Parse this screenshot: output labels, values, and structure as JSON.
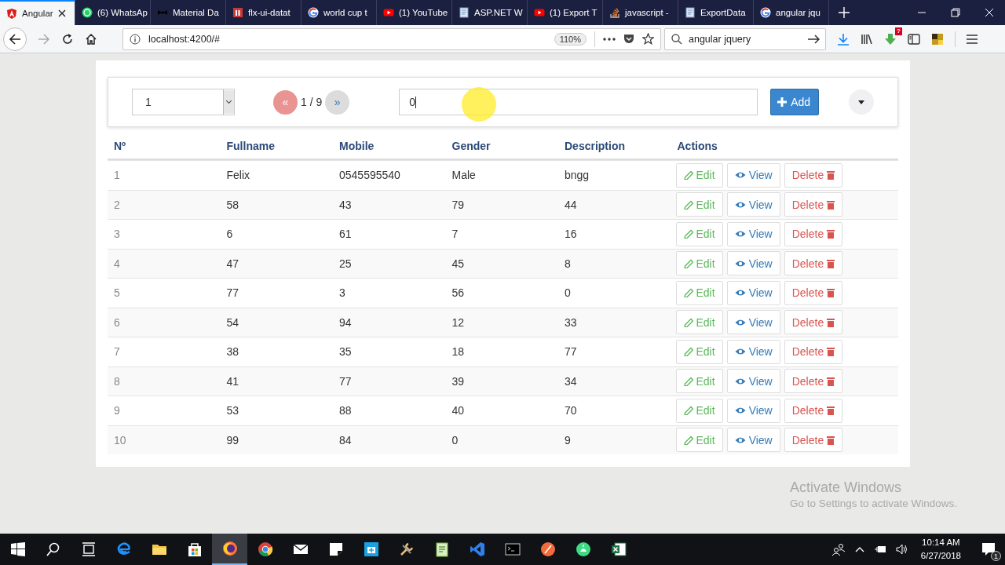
{
  "browser": {
    "tabs": [
      {
        "label": "Angular",
        "kind": "angular",
        "selected": true
      },
      {
        "label": "(6) WhatsAp",
        "kind": "whatsapp",
        "selected": false
      },
      {
        "label": "Material Da",
        "kind": "bowtie",
        "selected": false
      },
      {
        "label": "flx-ui-datat",
        "kind": "npm",
        "selected": false
      },
      {
        "label": "world cup t",
        "kind": "google",
        "selected": false
      },
      {
        "label": "(1) YouTube",
        "kind": "youtube",
        "selected": false
      },
      {
        "label": "ASP.NET W",
        "kind": "doc",
        "selected": false
      },
      {
        "label": "(1) Export T",
        "kind": "youtube",
        "selected": false
      },
      {
        "label": "javascript -",
        "kind": "stack",
        "selected": false
      },
      {
        "label": "ExportData",
        "kind": "doc",
        "selected": false
      },
      {
        "label": "angular jqu",
        "kind": "google",
        "selected": false
      }
    ],
    "url": "localhost:4200/#",
    "zoom": "110%",
    "search": "angular jquery",
    "addon_badge": "?"
  },
  "toolbar": {
    "page_size": "1",
    "pager": {
      "prev": "«",
      "text": "1 / 9",
      "next": "»"
    },
    "filter": "0",
    "add_button": "Add"
  },
  "table": {
    "columns": [
      "Nº",
      "Fullname",
      "Mobile",
      "Gender",
      "Description",
      "Actions"
    ],
    "rows": [
      {
        "cells": [
          "1",
          "Felix",
          "0545595540",
          "Male",
          "bngg"
        ],
        "actions": [
          "Edit",
          "View",
          "Delete"
        ]
      },
      {
        "cells": [
          "2",
          "58",
          "43",
          "79",
          "44"
        ],
        "actions": [
          "Edit",
          "View",
          "Delete"
        ]
      },
      {
        "cells": [
          "3",
          "6",
          "61",
          "7",
          "16"
        ],
        "actions": [
          "Edit",
          "View",
          "Delete"
        ]
      },
      {
        "cells": [
          "4",
          "47",
          "25",
          "45",
          "8"
        ],
        "actions": [
          "Edit",
          "View",
          "Delete"
        ]
      },
      {
        "cells": [
          "5",
          "77",
          "3",
          "56",
          "0"
        ],
        "actions": [
          "Edit",
          "View",
          "Delete"
        ]
      },
      {
        "cells": [
          "6",
          "54",
          "94",
          "12",
          "33"
        ],
        "actions": [
          "Edit",
          "View",
          "Delete"
        ]
      },
      {
        "cells": [
          "7",
          "38",
          "35",
          "18",
          "77"
        ],
        "actions": [
          "Edit",
          "View",
          "Delete"
        ]
      },
      {
        "cells": [
          "8",
          "41",
          "77",
          "39",
          "34"
        ],
        "actions": [
          "Edit",
          "View",
          "Delete"
        ]
      },
      {
        "cells": [
          "9",
          "53",
          "88",
          "40",
          "70"
        ],
        "actions": [
          "Edit",
          "View",
          "Delete"
        ]
      },
      {
        "cells": [
          "10",
          "99",
          "84",
          "0",
          "9"
        ],
        "actions": [
          "Edit",
          "View",
          "Delete"
        ]
      }
    ]
  },
  "os_notice": {
    "title": "Activate Windows",
    "text": "Go to Settings to activate Windows."
  },
  "taskbar": {
    "apps": [
      {
        "kind": "start",
        "selected": false
      },
      {
        "kind": "search",
        "selected": false
      },
      {
        "kind": "taskview",
        "selected": false
      },
      {
        "kind": "edge",
        "selected": false
      },
      {
        "kind": "folder",
        "selected": false
      },
      {
        "kind": "store",
        "selected": false
      },
      {
        "kind": "firefox",
        "selected": true
      },
      {
        "kind": "chrome",
        "selected": false
      },
      {
        "kind": "mail",
        "selected": false
      },
      {
        "kind": "notes",
        "selected": false
      },
      {
        "kind": "toolbox",
        "selected": false
      },
      {
        "kind": "tools",
        "selected": false
      },
      {
        "kind": "sheet",
        "selected": false
      },
      {
        "kind": "vscode",
        "selected": false
      },
      {
        "kind": "terminal",
        "selected": false
      },
      {
        "kind": "orange",
        "selected": false
      },
      {
        "kind": "android",
        "selected": false
      },
      {
        "kind": "excel",
        "selected": false
      }
    ],
    "time": "10:14 AM",
    "date": "6/27/2018",
    "notifications": "1"
  }
}
